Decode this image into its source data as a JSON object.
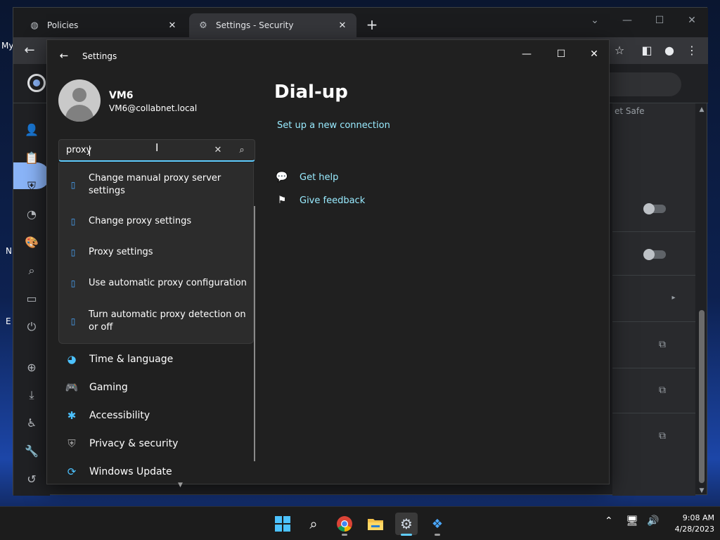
{
  "desktop": {
    "label": "My",
    "fragments": [
      "N",
      "E"
    ]
  },
  "browser": {
    "tabs": [
      {
        "label": "Policies",
        "icon": "globe-icon"
      },
      {
        "label": "Settings - Security",
        "icon": "gear-icon"
      }
    ],
    "new_tab": "+",
    "content_fragment": "et Safe"
  },
  "settings": {
    "window_title": "Settings",
    "user": {
      "name": "VM6",
      "email": "VM6@collabnet.local"
    },
    "search": {
      "value": "proxy"
    },
    "suggestions": [
      {
        "label": "Change manual proxy server settings"
      },
      {
        "label": "Change proxy settings"
      },
      {
        "label": "Proxy settings"
      },
      {
        "label": "Use automatic proxy configuration"
      },
      {
        "label": "Turn automatic proxy detection on or off"
      }
    ],
    "nav": [
      {
        "label": "Time & language",
        "icon": "globe-clock-icon"
      },
      {
        "label": "Gaming",
        "icon": "gamepad-icon"
      },
      {
        "label": "Accessibility",
        "icon": "accessibility-icon"
      },
      {
        "label": "Privacy & security",
        "icon": "shield-icon"
      },
      {
        "label": "Windows Update",
        "icon": "update-icon"
      }
    ],
    "page": {
      "title": "Dial-up",
      "setup_link": "Set up a new connection",
      "help": [
        {
          "label": "Get help",
          "icon": "help-chat-icon"
        },
        {
          "label": "Give feedback",
          "icon": "feedback-icon"
        }
      ]
    }
  },
  "taskbar": {
    "clock": {
      "time": "9:08 AM",
      "date": "4/28/2023"
    }
  },
  "colors": {
    "accent": "#60cdff",
    "link": "#99ebff",
    "chrome_active_nav": "#8ab4f8"
  }
}
